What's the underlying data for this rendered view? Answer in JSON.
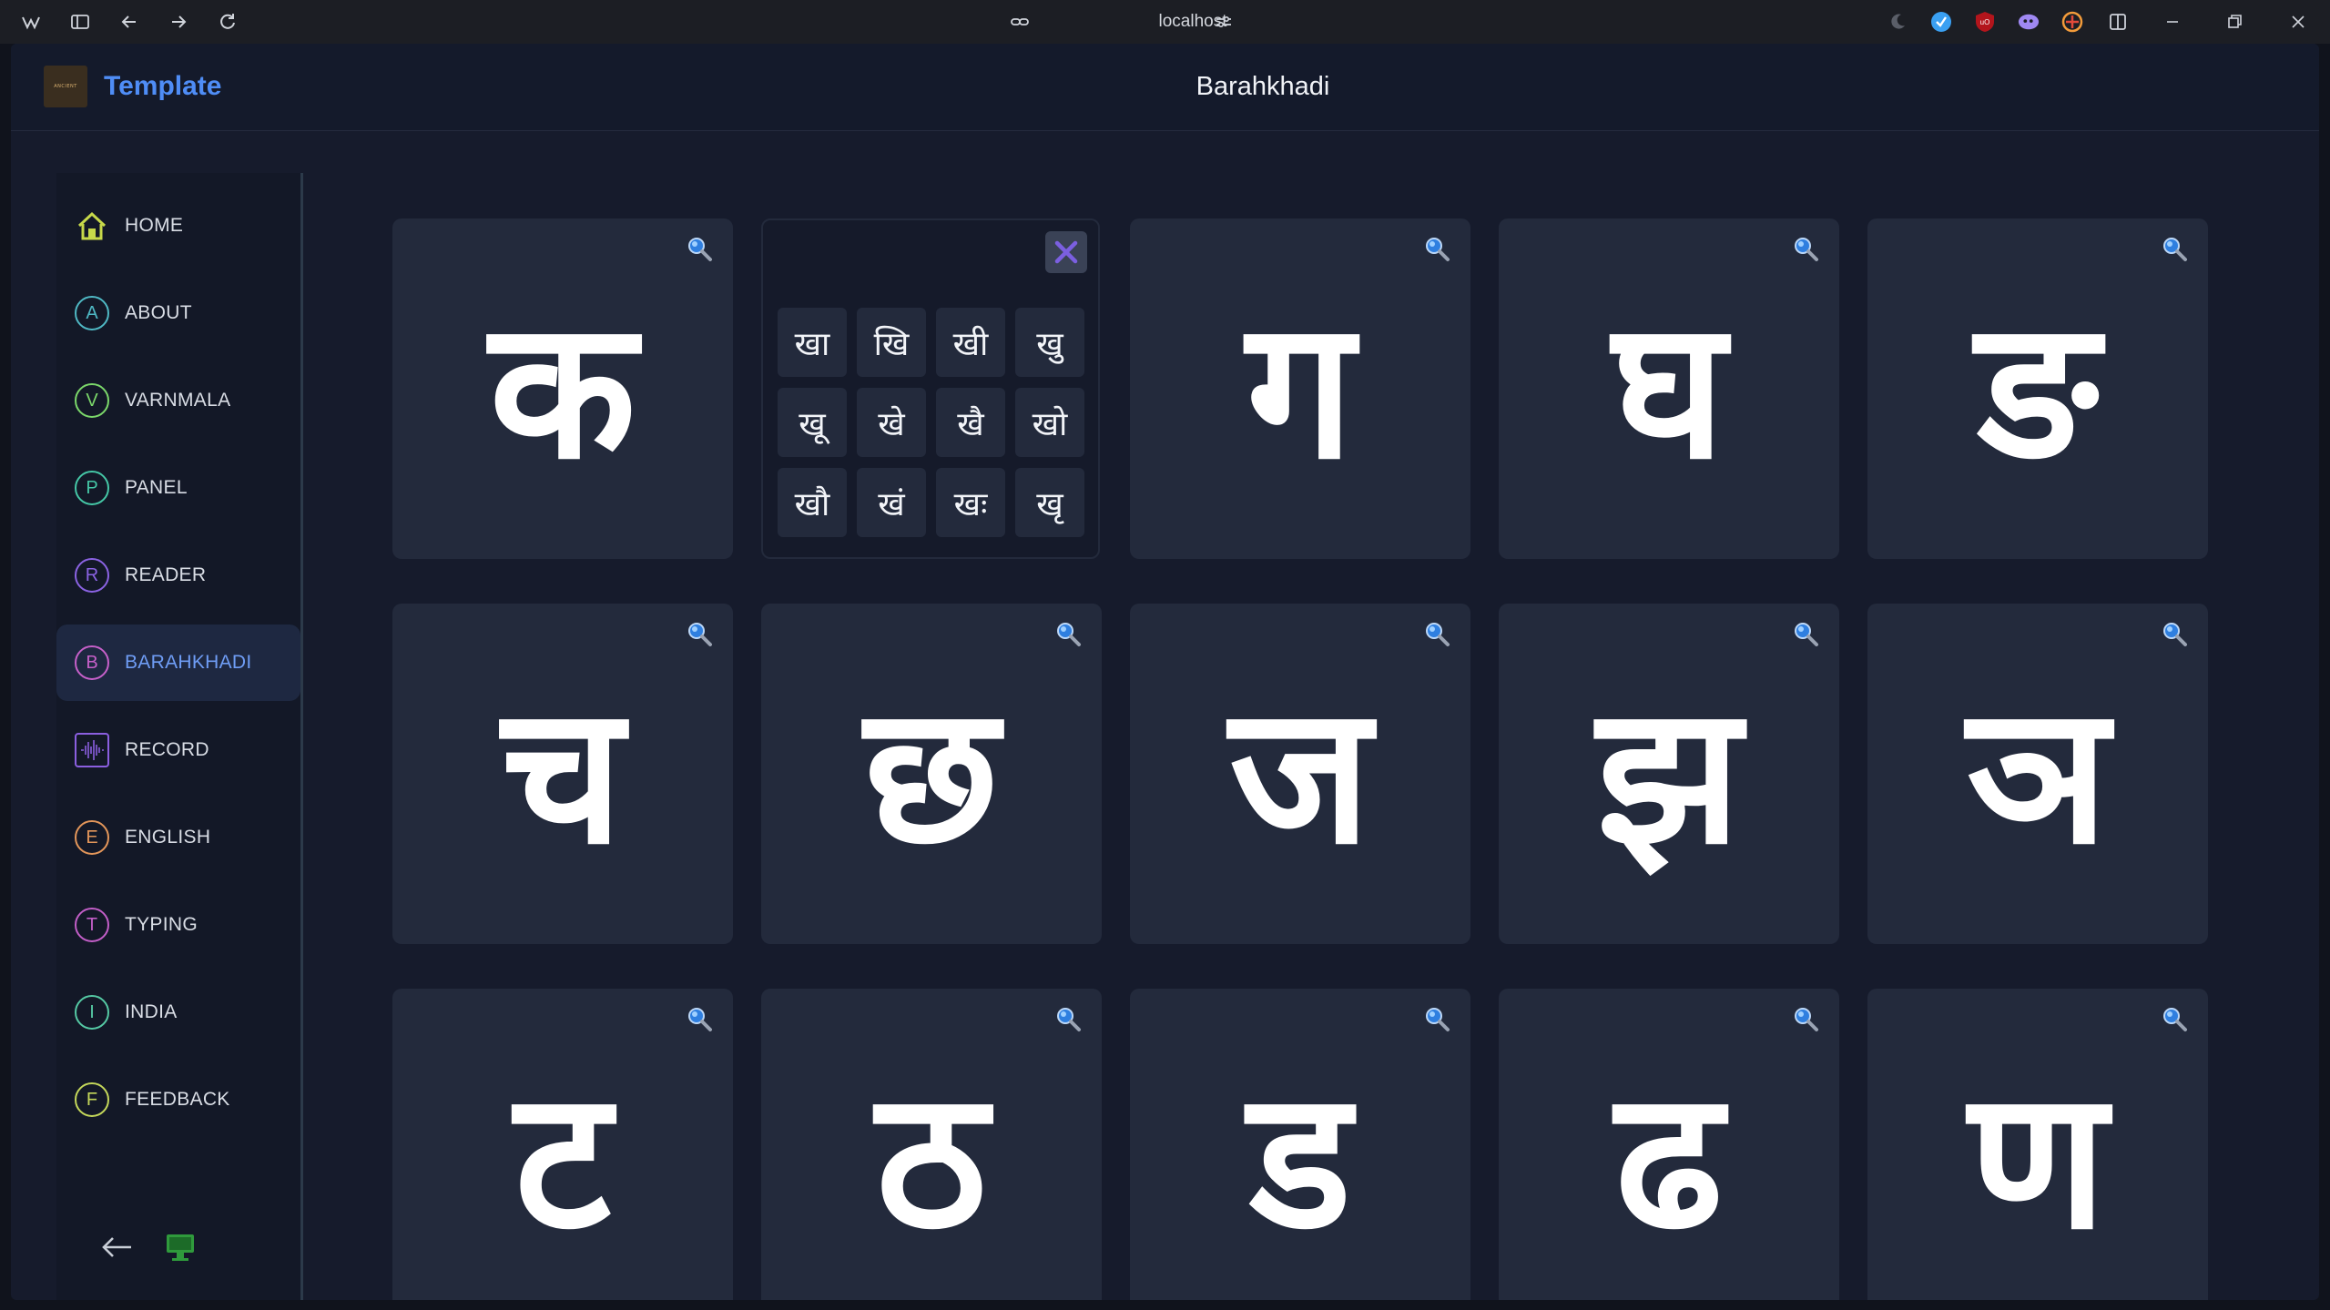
{
  "browser": {
    "url": "localhost"
  },
  "header": {
    "brand": "Template",
    "logo_text": "ANCIENT",
    "title": "Barahkhadi"
  },
  "sidebar": {
    "items": [
      {
        "label": "HOME",
        "badge": "",
        "icon": "home-icon",
        "color": "#c7d94a"
      },
      {
        "label": "ABOUT",
        "badge": "A",
        "icon": "",
        "color": "#4fb8c4"
      },
      {
        "label": "VARNMALA",
        "badge": "V",
        "icon": "",
        "color": "#7bd76a"
      },
      {
        "label": "PANEL",
        "badge": "P",
        "icon": "",
        "color": "#45c7a6"
      },
      {
        "label": "READER",
        "badge": "R",
        "icon": "",
        "color": "#8b63e3"
      },
      {
        "label": "BARAHKHADI",
        "badge": "B",
        "icon": "",
        "color": "#c660c9",
        "active": true
      },
      {
        "label": "RECORD",
        "badge": "",
        "icon": "waveform-icon",
        "color": "#8b5fe0"
      },
      {
        "label": "ENGLISH",
        "badge": "E",
        "icon": "",
        "color": "#e3965a"
      },
      {
        "label": "TYPING",
        "badge": "T",
        "icon": "",
        "color": "#c25ec7"
      },
      {
        "label": "INDIA",
        "badge": "I",
        "icon": "",
        "color": "#55c9a4"
      },
      {
        "label": "FEEDBACK",
        "badge": "F",
        "icon": "",
        "color": "#c4d75a"
      }
    ]
  },
  "letters": [
    "क",
    "",
    "ग",
    "घ",
    "ङ",
    "च",
    "छ",
    "ज",
    "झ",
    "ञ",
    "ट",
    "ठ",
    "ड",
    "ढ",
    "ण"
  ],
  "popup": {
    "variants": [
      "खा",
      "खि",
      "खी",
      "खु",
      "खू",
      "खे",
      "खै",
      "खो",
      "खौ",
      "खं",
      "खः",
      "खृ"
    ]
  },
  "colors": {
    "accent": "#4f8df6",
    "card": "#232a3c",
    "close_x": "#7b5fe0"
  }
}
